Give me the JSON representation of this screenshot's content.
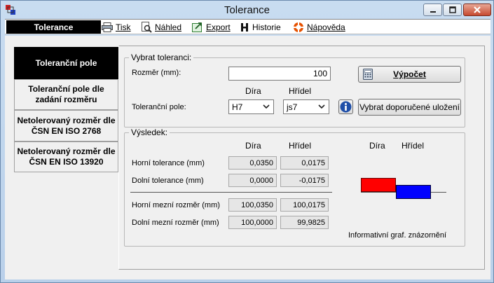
{
  "window": {
    "title": "Tolerance",
    "controls": {
      "minimize": "minimize",
      "maximize": "maximize",
      "close": "close"
    }
  },
  "menu": {
    "active": "Tolerance",
    "items": [
      {
        "label": "Tisk",
        "icon": "printer-icon"
      },
      {
        "label": "Náhled",
        "icon": "preview-icon"
      },
      {
        "label": "Export",
        "icon": "export-icon"
      },
      {
        "label": "Historie",
        "icon": "history-icon"
      },
      {
        "label": "Nápověda",
        "icon": "help-icon"
      }
    ]
  },
  "nav": [
    {
      "label": "Toleranční pole",
      "active": true
    },
    {
      "label": "Toleranční pole dle zadání rozměru",
      "active": false
    },
    {
      "label": "Netolerovaný rozměr dle ČSN EN ISO 2768",
      "active": false
    },
    {
      "label": "Netolerovaný rozměr dle ČSN EN ISO 13920",
      "active": false
    }
  ],
  "select_group": {
    "legend": "Vybrat toleranci:",
    "dimension_label": "Rozměr (mm):",
    "dimension_value": "100",
    "calc_button": "Výpočet",
    "col_hole": "Díra",
    "col_shaft": "Hřídel",
    "field_label": "Toleranční pole:",
    "hole_value": "H7",
    "shaft_value": "js7",
    "recommend_button": "Vybrat doporučené uložení"
  },
  "result_group": {
    "legend": "Výsledek:",
    "col_hole": "Díra",
    "col_shaft": "Hřídel",
    "rows": [
      {
        "label": "Horní tolerance (mm)",
        "hole": "0,0350",
        "shaft": "0,0175"
      },
      {
        "label": "Dolní tolerance (mm)",
        "hole": "0,0000",
        "shaft": "-0,0175"
      },
      {
        "label": "Horní mezní rozměr (mm)",
        "hole": "100,0350",
        "shaft": "100,0175"
      },
      {
        "label": "Dolní mezní rozměr (mm)",
        "hole": "100,0000",
        "shaft": "99,9825"
      }
    ],
    "graph": {
      "col_hole": "Díra",
      "col_shaft": "Hřídel",
      "caption": "Informativní graf. znázornění",
      "hole_color": "#ff0000",
      "shaft_color": "#0000ff"
    }
  }
}
